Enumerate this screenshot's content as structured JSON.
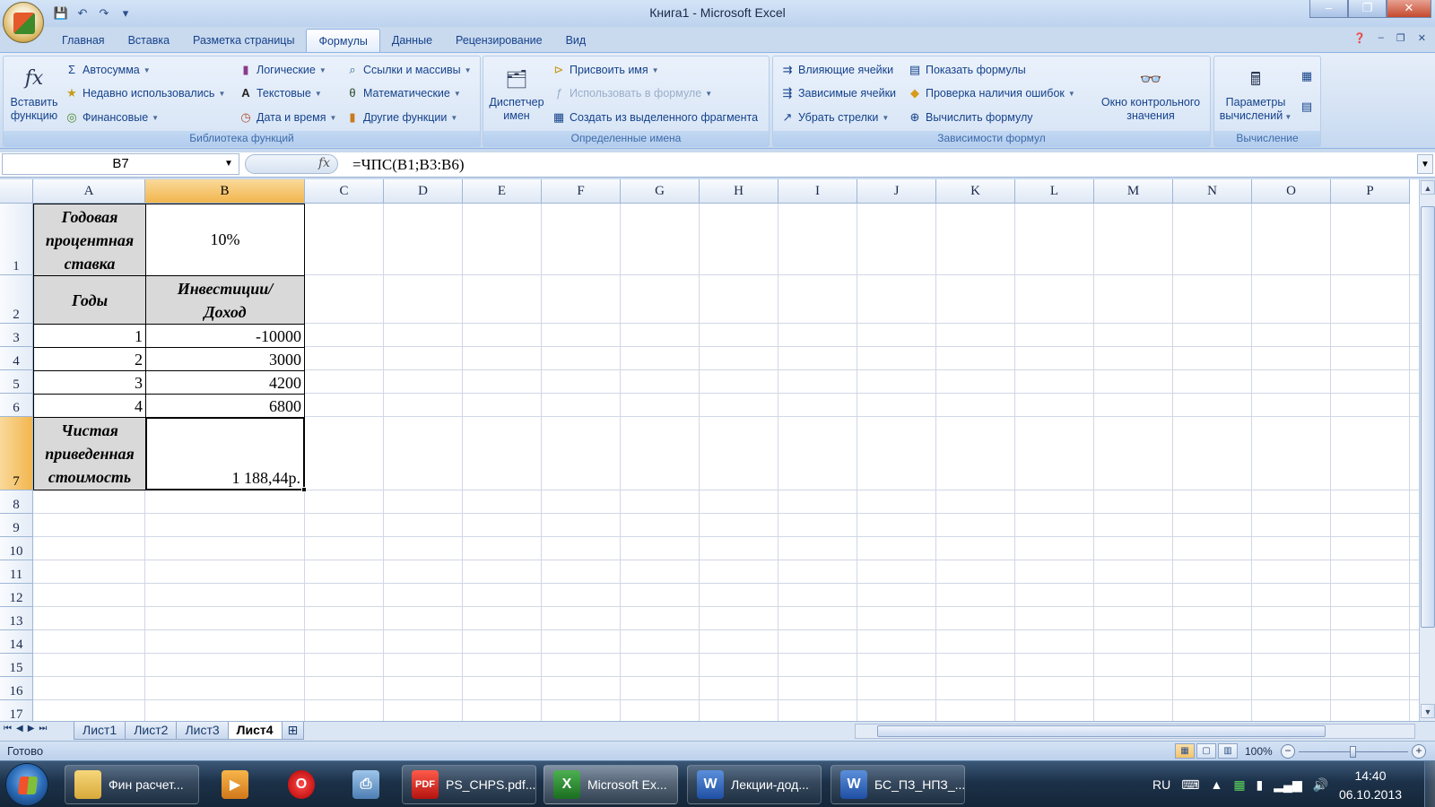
{
  "window": {
    "title": "Книга1 - Microsoft Excel",
    "controls": {
      "minimize": "–",
      "maximize": "❐",
      "close": "✕"
    }
  },
  "qat": {
    "save_icon": "save-icon",
    "undo_icon": "undo-icon",
    "redo_icon": "redo-icon",
    "customize_icon": "customize-icon"
  },
  "ribbon": {
    "tabs": [
      {
        "label": "Главная"
      },
      {
        "label": "Вставка"
      },
      {
        "label": "Разметка страницы"
      },
      {
        "label": "Формулы",
        "active": true
      },
      {
        "label": "Данные"
      },
      {
        "label": "Рецензирование"
      },
      {
        "label": "Вид"
      }
    ],
    "library": {
      "group_label": "Библиотека функций",
      "insert_function": "Вставить функцию",
      "insert_function_line1": "Вставить",
      "insert_function_line2": "функцию",
      "autosum": "Автосумма",
      "recently_used": "Недавно использовались",
      "financial": "Финансовые",
      "logical": "Логические",
      "text": "Текстовые",
      "datetime": "Дата и время",
      "lookup": "Ссылки и массивы",
      "math": "Математические",
      "more": "Другие функции"
    },
    "names": {
      "group_label": "Определенные имена",
      "manager_line1": "Диспетчер",
      "manager_line2": "имен",
      "define_name": "Присвоить имя",
      "use_in_formula": "Использовать в формуле",
      "create_from_selection": "Создать из выделенного фрагмента"
    },
    "auditing": {
      "group_label": "Зависимости формул",
      "trace_precedents": "Влияющие ячейки",
      "trace_dependents": "Зависимые ячейки",
      "remove_arrows": "Убрать стрелки",
      "show_formulas": "Показать формулы",
      "error_checking": "Проверка наличия ошибок",
      "evaluate_formula": "Вычислить формулу",
      "watch_line1": "Окно контрольного",
      "watch_line2": "значения"
    },
    "calculation": {
      "group_label": "Вычисление",
      "options_line1": "Параметры",
      "options_line2": "вычислений"
    }
  },
  "formula_bar": {
    "name_box": "B7",
    "fx": "fx",
    "formula": "=ЧПС(B1;B3:B6)"
  },
  "grid": {
    "columns": [
      "A",
      "B",
      "C",
      "D",
      "E",
      "F",
      "G",
      "H",
      "I",
      "J",
      "K",
      "L",
      "M",
      "N",
      "O",
      "P"
    ],
    "rows": [
      "1",
      "2",
      "3",
      "4",
      "5",
      "6",
      "7",
      "8",
      "9",
      "10",
      "11",
      "12",
      "13",
      "14",
      "15",
      "16",
      "17"
    ],
    "selected_column": "B",
    "selected_row": "7",
    "cells": {
      "A1_line1": "Годовая",
      "A1_line2": "процентная",
      "A1_line3": "ставка",
      "B1": "10%",
      "A2": "Годы",
      "B2_line1": "Инвестиции/",
      "B2_line2": "Доход",
      "A3": "1",
      "B3": "-10000",
      "A4": "2",
      "B4": "3000",
      "A5": "3",
      "B5": "4200",
      "A6": "4",
      "B6": "6800",
      "A7_line1": "Чистая",
      "A7_line2": "приведенная",
      "A7_line3": "стоимость",
      "B7": "1 188,44р."
    }
  },
  "sheets": {
    "tabs": [
      "Лист1",
      "Лист2",
      "Лист3",
      "Лист4"
    ],
    "active": "Лист4"
  },
  "status": {
    "ready": "Готово",
    "zoom": "100%"
  },
  "taskbar": {
    "items": [
      {
        "label": "Фин расчет..."
      },
      {
        "label": "PS_CHPS.pdf..."
      },
      {
        "label": "Microsoft Ex...",
        "active": true
      },
      {
        "label": "Лекции-дод..."
      },
      {
        "label": "БС_ПЗ_НПЗ_..."
      }
    ],
    "lang": "RU",
    "time": "14:40",
    "date": "06.10.2013"
  }
}
